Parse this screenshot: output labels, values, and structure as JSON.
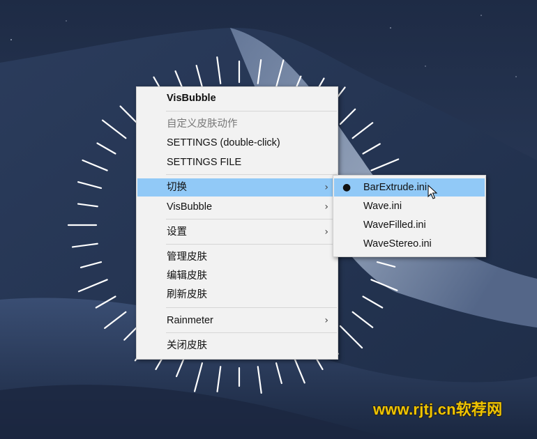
{
  "main_menu": {
    "items": [
      {
        "label": "VisBubble",
        "style": "title"
      },
      {
        "label": "自定义皮肤动作",
        "style": "disabled"
      },
      {
        "label": "SETTINGS (double-click)"
      },
      {
        "label": "SETTINGS FILE"
      },
      {
        "label": "切换",
        "submenu": true,
        "highlighted": true
      },
      {
        "label": "VisBubble",
        "submenu": true
      },
      {
        "label": "设置",
        "submenu": true
      },
      {
        "label": "管理皮肤"
      },
      {
        "label": "编辑皮肤"
      },
      {
        "label": "刷新皮肤"
      },
      {
        "label": "Rainmeter",
        "submenu": true
      },
      {
        "label": "关闭皮肤"
      }
    ]
  },
  "sub_menu": {
    "items": [
      {
        "label": "BarExtrude.ini",
        "selected": true,
        "highlighted": true
      },
      {
        "label": "Wave.ini"
      },
      {
        "label": "WaveFilled.ini"
      },
      {
        "label": "WaveStereo.ini"
      }
    ]
  },
  "glyphs": {
    "arrow": "›",
    "bullet": "●"
  },
  "watermark": "www.rjtj.cn软荐网",
  "colors": {
    "highlight": "#91c9f7",
    "menu_bg": "#f2f2f2",
    "sky": "#22304c",
    "dune_dark": "#253553",
    "dune_light": "#8e9fbb",
    "visualizer_bars": "#ffffff"
  },
  "icons": [
    "submenu-arrow-icon",
    "selected-bullet-icon",
    "mouse-cursor-icon"
  ]
}
